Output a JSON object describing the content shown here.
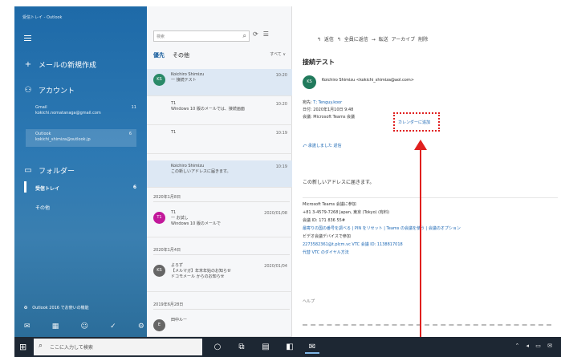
{
  "app": {
    "window_title": "受信トレイ - Outlook"
  },
  "sidebar": {
    "new_mail": "メールの新規作成",
    "accounts_label": "アカウント",
    "accounts": [
      {
        "name": "Gmail",
        "email": "kokichi.nomatanaga@gmail.com",
        "count": "11"
      },
      {
        "name": "Outlook",
        "email": "kokichi_shimiza@outlook.jp",
        "count": "6"
      }
    ],
    "folders_label": "フォルダー",
    "folders": [
      {
        "name": "受信トレイ",
        "count": "6"
      },
      {
        "name": "その他",
        "count": ""
      }
    ],
    "promo": "Outlook 2016 でお使いの機能"
  },
  "list": {
    "search_placeholder": "検索",
    "tabs": {
      "focused": "優先",
      "other": "その他",
      "filter": "すべて ∨"
    },
    "items": [
      {
        "avatar": "KS",
        "avatar_color": "#2a8a68",
        "sender": "Koichiro Shimizu",
        "preview": "一 接続テスト",
        "date": "10:20",
        "selected": true
      },
      {
        "avatar": "",
        "avatar_color": "",
        "sender": "T1",
        "preview": "Windows 10 版のメールでは、接続画面",
        "date": "10:20",
        "selected": false
      },
      {
        "avatar": "",
        "avatar_color": "",
        "sender": "T1",
        "preview": "",
        "date": "10:19",
        "selected": false
      },
      {
        "avatar": "",
        "avatar_color": "",
        "sender": "Koichiro Shimizu",
        "preview": "この新しいアドレスに届きます。",
        "date": "10:19",
        "selected": true
      }
    ],
    "date_headers": [
      "2020年1月8日",
      "2020年1月4日",
      "2019年6月28日"
    ],
    "items2": [
      {
        "avatar": "T1",
        "avatar_color": "#c2189a",
        "sender": "T1",
        "preview": "一 お試し",
        "sub": "Windows 10 版のメールで",
        "date": "2020/01/08"
      },
      {
        "avatar": "KS",
        "avatar_color": "#666666",
        "sender": "よろず",
        "preview": "【メルマガ】年末年始のお知らせ",
        "sub": "ドコモメール からのお知らせ",
        "date": "2020/01/04"
      },
      {
        "avatar": "E",
        "avatar_color": "#666666",
        "sender": "田中ルー",
        "preview": "",
        "sub": "",
        "date": ""
      }
    ]
  },
  "toolbar": {
    "reply": "↰ 返信",
    "reply_all": "↰ 全員に返信",
    "forward": "→ 転送",
    "archive": "アーカイブ",
    "delete": "削除"
  },
  "message": {
    "subject": "接続テスト",
    "avatar": "KS",
    "from": "Koichiro Shimizu <kokichi_shimiza@aol.com>",
    "to_label": "宛先",
    "to_value": "T; Tenguy.koor",
    "date_line": "日付: 2020年1月10日 9:48",
    "teams_line": "会議: Microsoft Teams 会議",
    "highlight": "カレンダーに追加",
    "reply_link": "⤺ 承諾しました   返信",
    "line1": "この新しいアドレスに届きます。",
    "body": [
      "Microsoft Teams 会議に参加",
      "+81 3-4579-7268   Japan, 東京 (Tokyo) (有料)",
      "会議 ID: 171 836 55#",
      "最寄りの国の番号を調べる | PIN をリセット | Teams の会議を使う | 会議のオプション",
      "ビデオ会議デバイスで参加",
      "2273582361@t.plcm.vc VTC 会議 ID: 1138817018",
      "代替 VTC のダイヤル方法"
    ],
    "help": "ヘルプ"
  },
  "taskbar": {
    "search": "ここに入力して検索"
  }
}
